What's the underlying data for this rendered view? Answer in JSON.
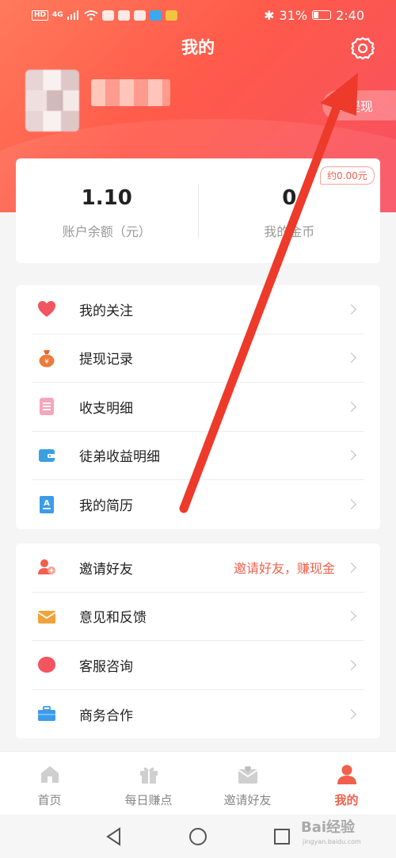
{
  "status_bar": {
    "network": "HD",
    "signal": "4G",
    "battery_percent": "31%",
    "battery_level": 0.31,
    "time": "2:40"
  },
  "header": {
    "title": "我的",
    "withdraw_label": "提现"
  },
  "balance": {
    "account_value": "1.10",
    "account_label": "账户余额（元）",
    "coins_value": "0",
    "coins_label": "我的金币",
    "coins_badge": "约0.00元"
  },
  "menu_group_1": [
    {
      "label": "我的关注",
      "icon": "heart-icon",
      "color": "#f25560"
    },
    {
      "label": "提现记录",
      "icon": "money-bag-icon",
      "color": "#ef7a3a"
    },
    {
      "label": "收支明细",
      "icon": "ledger-icon",
      "color": "#f0809a"
    },
    {
      "label": "徒弟收益明细",
      "icon": "wallet-icon",
      "color": "#3aa0e0"
    },
    {
      "label": "我的简历",
      "icon": "resume-icon",
      "color": "#3d9be9"
    }
  ],
  "menu_group_2": [
    {
      "label": "邀请好友",
      "extra": "邀请好友，赚现金",
      "icon": "add-user-icon",
      "color": "#f0604c"
    },
    {
      "label": "意见和反馈",
      "icon": "mail-icon",
      "color": "#f2a23a"
    },
    {
      "label": "客服咨询",
      "icon": "chat-icon",
      "color": "#f25560"
    },
    {
      "label": "商务合作",
      "icon": "briefcase-icon",
      "color": "#3d9be9"
    }
  ],
  "tabbar": [
    {
      "label": "首页",
      "icon": "home-icon"
    },
    {
      "label": "每日赚点",
      "icon": "gift-icon"
    },
    {
      "label": "邀请好友",
      "icon": "invite-icon"
    },
    {
      "label": "我的",
      "icon": "profile-icon",
      "active": true
    }
  ],
  "watermark": {
    "text": "Bai经验",
    "sub": "jingyan.baidu.com"
  },
  "colors": {
    "accent": "#f0604c",
    "header_start": "#ff7a5c",
    "header_end": "#f85062"
  }
}
